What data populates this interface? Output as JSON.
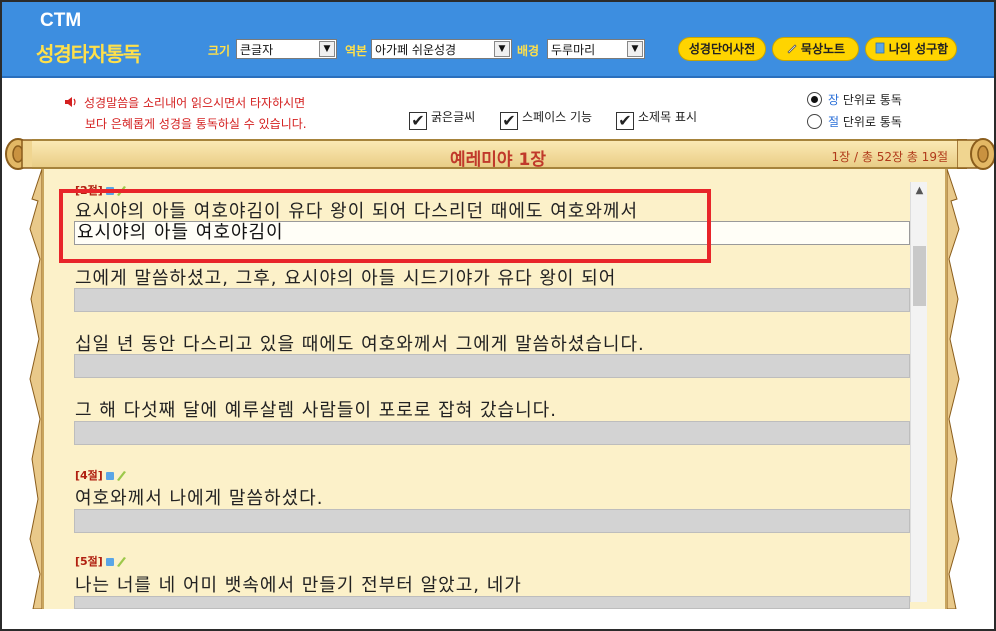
{
  "header": {
    "logo_top": "CTM",
    "logo_bottom": "성경타자통독",
    "size": {
      "label": "크기",
      "value": "큰글자"
    },
    "version": {
      "label": "역본",
      "value": "아가페 쉬운성경"
    },
    "background": {
      "label": "배경",
      "value": "두루마리"
    },
    "buttons": {
      "dictionary": "성경단어사전",
      "meditation": "묵상노트",
      "my_verses": "나의 성구함"
    }
  },
  "notice": {
    "line1": "성경말씀을 소리내어 읽으시면서 타자하시면",
    "line2": "보다 은혜롭게 성경을 통독하실 수 있습니다."
  },
  "options": {
    "bold": "굵은글씨",
    "space": "스페이스 기능",
    "subtitle": "소제목 표시",
    "check_mark": "✔"
  },
  "mode": {
    "chapter_prefix": "장",
    "chapter_suffix": " 단위로 통독",
    "verse_prefix": "절",
    "verse_suffix": " 단위로 통독"
  },
  "scroll": {
    "chapter_title": "예레미야 1장",
    "count": "1장 / 총 52장   총 19절"
  },
  "verses": {
    "v2": {
      "label": "[2절]"
    },
    "l1": {
      "text": "요시야의 아들 여호야김이 유다 왕이 되어 다스리던 때에도 여호와께서",
      "typed": "요시야의 아들 여호야김이"
    },
    "l2": {
      "text": "그에게 말씀하셨고, 그후, 요시야의 아들 시드기야가 유다 왕이 되어"
    },
    "l3": {
      "text": "십일 년 동안 다스리고 있을 때에도 여호와께서 그에게 말씀하셨습니다."
    },
    "l4": {
      "text": "그 해 다섯째 달에 예루살렘 사람들이 포로로 잡혀 갔습니다."
    },
    "v4": {
      "label": "[4절]",
      "text": "여호와께서 나에게 말씀하셨다."
    },
    "v5": {
      "label": "[5절]",
      "text": "나는 너를 네 어미 뱃속에서 만들기 전부터 알았고, 네가"
    }
  },
  "colors": {
    "header": "#3d8ee0",
    "accent": "#ffd400",
    "highlight": "#e8252a",
    "paper": "#fcf1c9"
  }
}
